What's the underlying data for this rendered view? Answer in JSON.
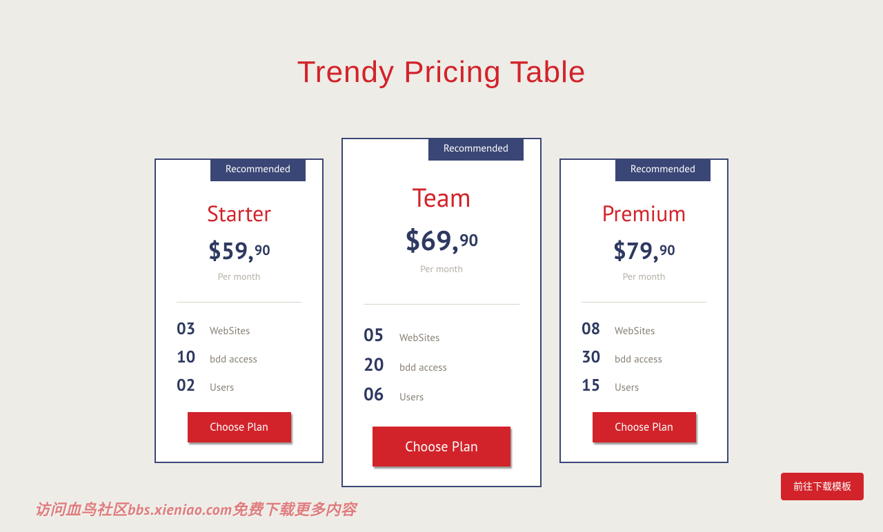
{
  "title": "Trendy Pricing Table",
  "badge_text": "Recommended",
  "period_text": "Per month",
  "cta_text": "Choose Plan",
  "currency": "$",
  "plans": [
    {
      "name": "Starter",
      "price_main": "59,",
      "price_cents": "90",
      "features": [
        {
          "count": "03",
          "label": "WebSites"
        },
        {
          "count": "10",
          "label": "bdd access"
        },
        {
          "count": "02",
          "label": "Users"
        }
      ]
    },
    {
      "name": "Team",
      "price_main": "69,",
      "price_cents": "90",
      "features": [
        {
          "count": "05",
          "label": "WebSites"
        },
        {
          "count": "20",
          "label": "bdd access"
        },
        {
          "count": "06",
          "label": "Users"
        }
      ]
    },
    {
      "name": "Premium",
      "price_main": "79,",
      "price_cents": "90",
      "features": [
        {
          "count": "08",
          "label": "WebSites"
        },
        {
          "count": "30",
          "label": "bdd access"
        },
        {
          "count": "15",
          "label": "Users"
        }
      ]
    }
  ],
  "watermark": "访问血鸟社区bbs.xieniao.com免费下载更多内容",
  "download_label": "前往下载模板"
}
